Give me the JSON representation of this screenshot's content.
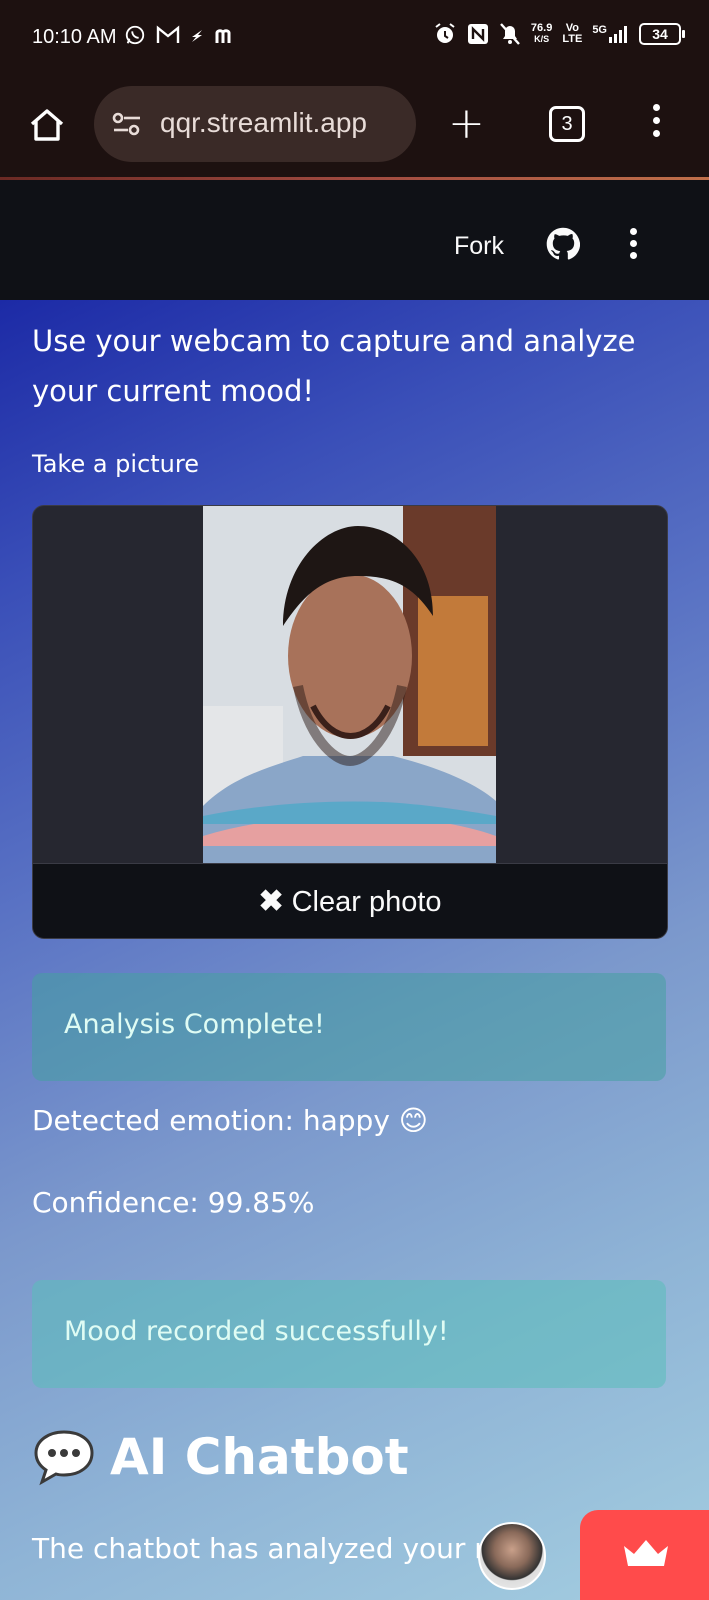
{
  "status_bar": {
    "time": "10:10 AM",
    "net_speed": "76.9",
    "net_unit": "K/S",
    "volte_top": "Vo",
    "volte_bottom": "LTE",
    "network": "5G",
    "battery": "34"
  },
  "browser": {
    "url": "qqr.streamlit.app",
    "tab_count": "3"
  },
  "app_header": {
    "fork_label": "Fork"
  },
  "main": {
    "intro": "Use your webcam to capture and analyze your current mood!",
    "camera_label": "Take a picture",
    "clear_photo_icon": "✖",
    "clear_photo_label": "Clear photo",
    "analysis_alert": "Analysis Complete!",
    "emotion_text": "Detected emotion: happy 😊",
    "confidence_text": "Confidence: 99.85%",
    "mood_alert": "Mood recorded successfully!",
    "chat_title": "AI Chatbot",
    "chat_intro": "The chatbot has analyzed your mo"
  },
  "colors": {
    "status_bg": "#1d1110",
    "header_bg": "#0f1116",
    "manage_button": "#ff4b4b",
    "alert_bg": "#4aa0a0"
  }
}
